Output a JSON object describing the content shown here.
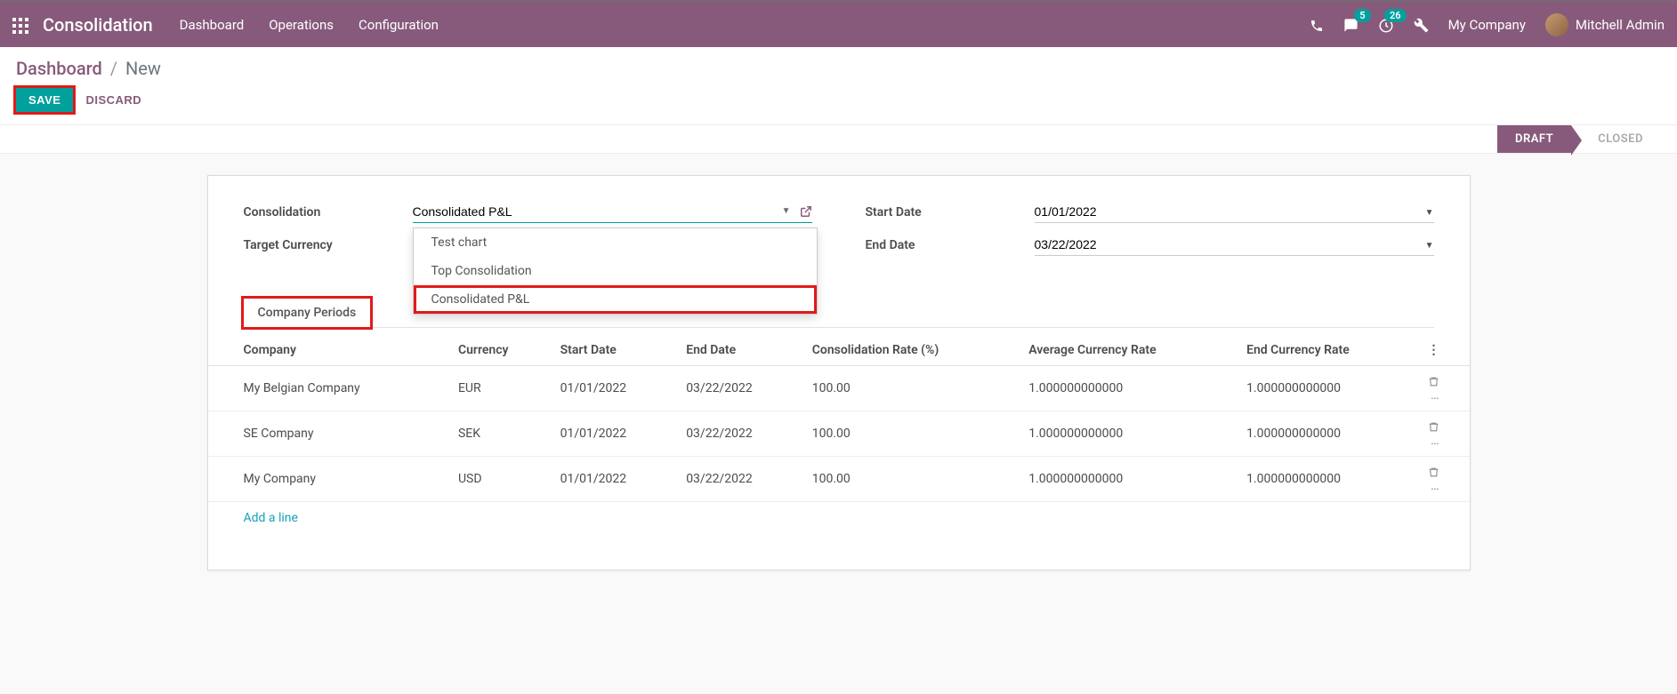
{
  "navbar": {
    "brand": "Consolidation",
    "menu": [
      "Dashboard",
      "Operations",
      "Configuration"
    ],
    "badge_messages": "5",
    "badge_activities": "26",
    "company": "My Company",
    "user": "Mitchell Admin"
  },
  "breadcrumb": {
    "parent": "Dashboard",
    "current": "New"
  },
  "actions": {
    "save": "SAVE",
    "discard": "DISCARD"
  },
  "status": {
    "draft": "DRAFT",
    "closed": "CLOSED"
  },
  "form": {
    "consolidation_label": "Consolidation",
    "consolidation_value": "Consolidated P&L",
    "target_currency_label": "Target Currency",
    "start_date_label": "Start Date",
    "start_date_value": "01/01/2022",
    "end_date_label": "End Date",
    "end_date_value": "03/22/2022",
    "dropdown_options": [
      "Test chart",
      "Top Consolidation",
      "Consolidated P&L"
    ]
  },
  "tab": {
    "company_periods": "Company Periods"
  },
  "table": {
    "headers": {
      "company": "Company",
      "currency": "Currency",
      "start": "Start Date",
      "end": "End Date",
      "rate": "Consolidation Rate (%)",
      "avg": "Average Currency Rate",
      "endrate": "End Currency Rate"
    },
    "rows": [
      {
        "company": "My Belgian Company",
        "currency": "EUR",
        "start": "01/01/2022",
        "end": "03/22/2022",
        "rate": "100.00",
        "avg": "1.000000000000",
        "endrate": "1.000000000000"
      },
      {
        "company": "SE Company",
        "currency": "SEK",
        "start": "01/01/2022",
        "end": "03/22/2022",
        "rate": "100.00",
        "avg": "1.000000000000",
        "endrate": "1.000000000000"
      },
      {
        "company": "My Company",
        "currency": "USD",
        "start": "01/01/2022",
        "end": "03/22/2022",
        "rate": "100.00",
        "avg": "1.000000000000",
        "endrate": "1.000000000000"
      }
    ],
    "addline": "Add a line"
  }
}
